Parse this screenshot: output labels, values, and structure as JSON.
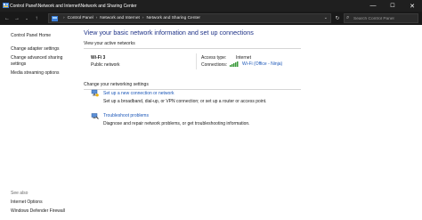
{
  "window": {
    "title": "Control Panel\\Network and Internet\\Network and Sharing Center",
    "minimize_glyph": "—",
    "maximize_glyph": "☐",
    "close_glyph": "✕"
  },
  "addressbar": {
    "crumbs": [
      "Control Panel",
      "Network and Internet",
      "Network and Sharing Center"
    ],
    "separator": "›",
    "search_placeholder": "Search Control Panel"
  },
  "sidebar": {
    "links": [
      "Control Panel Home",
      "Change adapter settings",
      "Change advanced sharing",
      "settings",
      "Media streaming options"
    ],
    "see_also_label": "See also",
    "see_also_links": [
      "Internet Options",
      "Windows Defender Firewall"
    ]
  },
  "main": {
    "heading": "View your basic network information and set up connections",
    "active_label": "View your active networks",
    "network": {
      "name": "Wi-Fi 3",
      "category": "Public network",
      "access_type_label": "Access type:",
      "access_type_value": "Internet",
      "connections_label": "Connections:",
      "connection_name": "Wi-Fi (Office - Ninja)"
    },
    "change_label": "Change your networking settings",
    "tasks": [
      {
        "icon": "network-setup-icon",
        "link": "Set up a new connection or network",
        "desc": "Set up a broadband, dial-up, or VPN connection; or set up a router or access point."
      },
      {
        "icon": "troubleshoot-icon",
        "link": "Troubleshoot problems",
        "desc": "Diagnose and repair network problems, or get troubleshooting information."
      }
    ]
  },
  "colors": {
    "titlebar_bg": "#1f1f1f",
    "addressbar_bg": "#191919",
    "heading": "#1e3287",
    "link": "#1a56b8",
    "wifi_green": "#3a9a3a"
  }
}
